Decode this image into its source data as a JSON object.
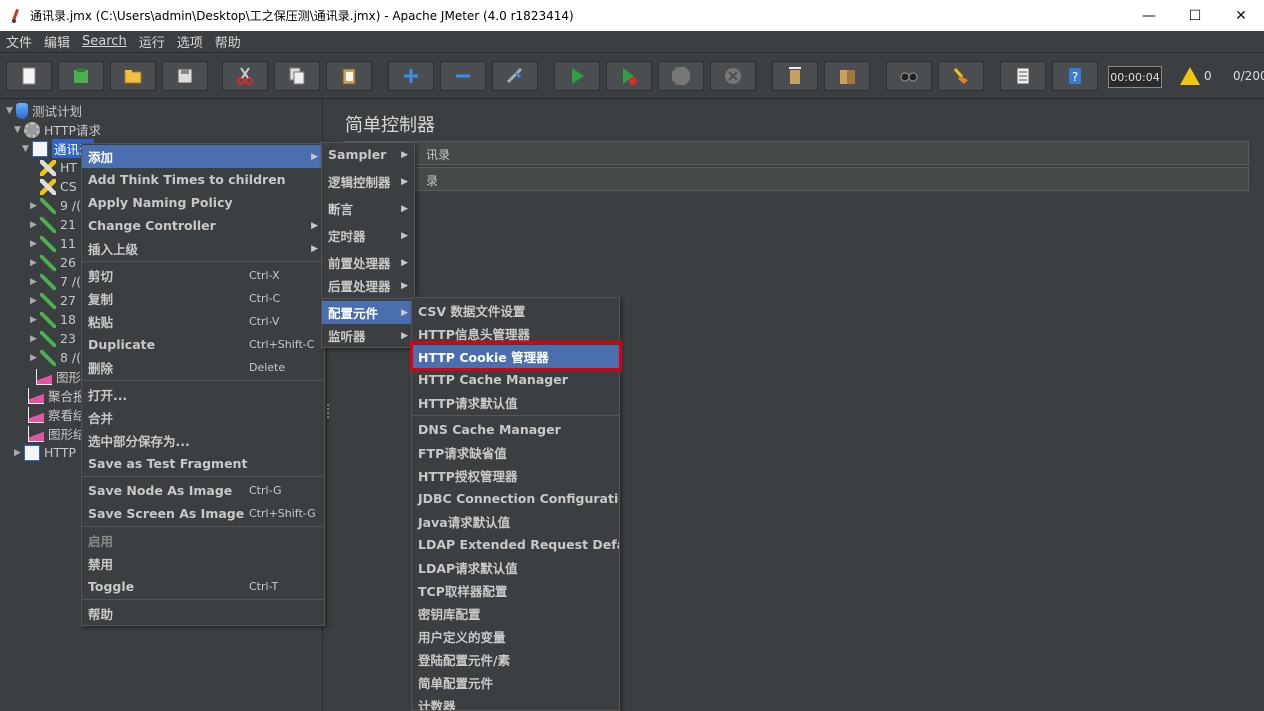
{
  "window": {
    "title": "通讯录.jmx (C:\\Users\\admin\\Desktop\\工之保压测\\通讯录.jmx) - Apache JMeter (4.0 r1823414)",
    "minimize": "—",
    "maximize": "☐",
    "close": "✕"
  },
  "menubar": [
    "文件",
    "编辑",
    "Search",
    "运行",
    "选项",
    "帮助"
  ],
  "toolbar": {
    "timer": "00:00:04",
    "warnings": "0",
    "threads": "0/200"
  },
  "tree": {
    "root": "测试计划",
    "thread_group": "HTTP请求",
    "selected": "通讯录",
    "children": [
      "HT",
      "CS",
      "9 /(",
      "21",
      "11",
      "26",
      "7 /(",
      "27",
      "18",
      "23",
      "8 /("
    ],
    "listeners": [
      "图形结",
      "聚合报",
      "察看结",
      "图形结"
    ],
    "second_group": "HTTP"
  },
  "right_panel": {
    "heading": "简单控制器",
    "name_value": "讯录",
    "comment_value": "录"
  },
  "context_menu": {
    "items": [
      {
        "label": "添加",
        "submenu": true,
        "highlight": true
      },
      {
        "label": "Add Think Times to children"
      },
      {
        "label": "Apply Naming Policy"
      },
      {
        "label": "Change Controller",
        "submenu": true
      },
      {
        "label": "插入上级",
        "submenu": true
      },
      {
        "label": "剪切",
        "shortcut": "Ctrl-X"
      },
      {
        "label": "复制",
        "shortcut": "Ctrl-C"
      },
      {
        "label": "粘贴",
        "shortcut": "Ctrl-V"
      },
      {
        "label": "Duplicate",
        "shortcut": "Ctrl+Shift-C"
      },
      {
        "label": "删除",
        "shortcut": "Delete"
      },
      {
        "label": "打开..."
      },
      {
        "label": "合并"
      },
      {
        "label": "选中部分保存为..."
      },
      {
        "label": "Save as Test Fragment"
      },
      {
        "label": "Save Node As Image",
        "shortcut": "Ctrl-G"
      },
      {
        "label": "Save Screen As Image",
        "shortcut": "Ctrl+Shift-G"
      },
      {
        "label": "启用"
      },
      {
        "label": "禁用"
      },
      {
        "label": "Toggle",
        "shortcut": "Ctrl-T"
      },
      {
        "label": "帮助"
      }
    ]
  },
  "add_submenu": {
    "items": [
      "Sampler",
      "逻辑控制器",
      "断言",
      "定时器",
      "前置处理器",
      "后置处理器",
      "配置元件",
      "监听器"
    ],
    "highlight": "配置元件"
  },
  "config_submenu": {
    "items": [
      "CSV 数据文件设置",
      "HTTP信息头管理器",
      "HTTP Cookie 管理器",
      "HTTP Cache Manager",
      "HTTP请求默认值",
      "DNS Cache Manager",
      "FTP请求缺省值",
      "HTTP授权管理器",
      "JDBC Connection Configuration",
      "Java请求默认值",
      "LDAP Extended Request Defaults",
      "LDAP请求默认值",
      "TCP取样器配置",
      "密钥库配置",
      "用户定义的变量",
      "登陆配置元件/素",
      "简单配置元件",
      "计数器"
    ],
    "highlight": "HTTP Cookie 管理器"
  },
  "colors": {
    "background": "#3c3f41",
    "highlight": "#4b6eaf",
    "selection": "#2f65ca",
    "annotation": "#e0000c"
  }
}
